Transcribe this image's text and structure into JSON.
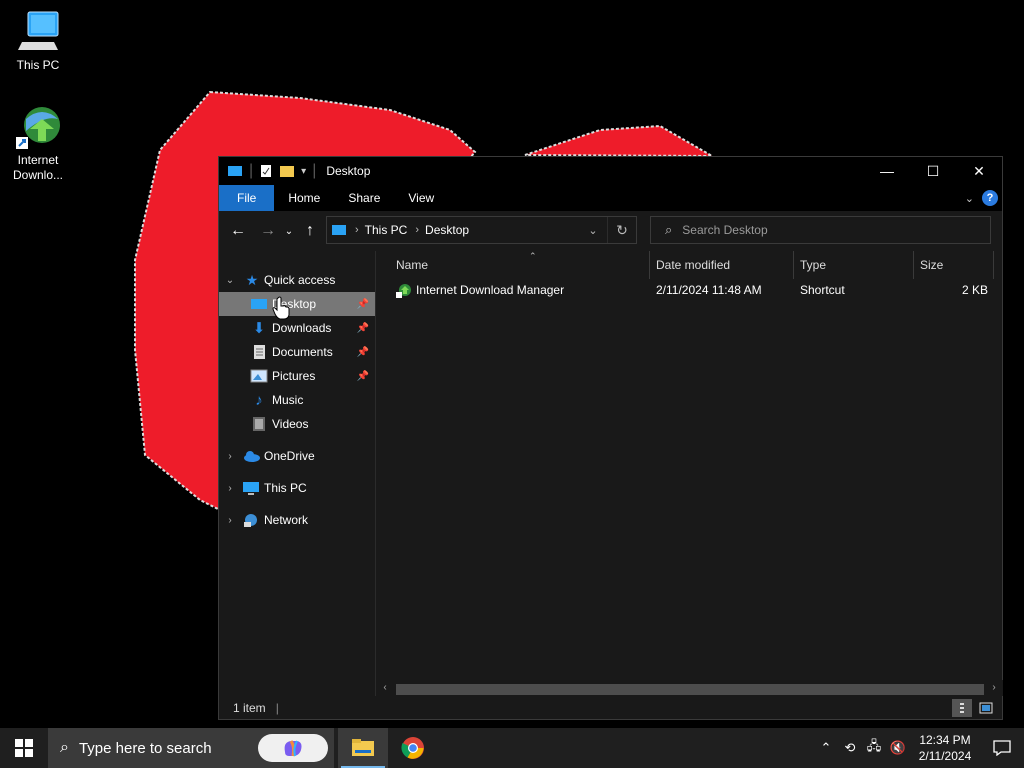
{
  "desktop": {
    "icons": [
      {
        "label": "This PC",
        "icon": "computer-icon"
      },
      {
        "label": "Internet Downlo...",
        "icon": "idm-icon"
      }
    ],
    "wallpaper_shape_color": "#ee1c2a"
  },
  "window": {
    "title": "Desktop",
    "controls": {
      "minimize": "—",
      "maximize": "☐",
      "close": "✕"
    },
    "ribbon": {
      "tabs": [
        "File",
        "Home",
        "Share",
        "View"
      ]
    },
    "address": {
      "segments": [
        "This PC",
        "Desktop"
      ]
    },
    "search": {
      "placeholder": "Search Desktop"
    },
    "nav": {
      "quick_access": "Quick access",
      "pinned": [
        "Desktop",
        "Downloads",
        "Documents",
        "Pictures"
      ],
      "unpinned": [
        "Music",
        "Videos"
      ],
      "roots": [
        "OneDrive",
        "This PC",
        "Network"
      ]
    },
    "columns": {
      "name": "Name",
      "date": "Date modified",
      "type": "Type",
      "size": "Size"
    },
    "files": [
      {
        "name": "Internet Download Manager",
        "date": "2/11/2024 11:48 AM",
        "type": "Shortcut",
        "size": "2 KB"
      }
    ],
    "status": {
      "count": "1 item"
    }
  },
  "taskbar": {
    "search_placeholder": "Type here to search",
    "time": "12:34 PM",
    "date": "2/11/2024"
  },
  "colors": {
    "accent": "#1a6fc7",
    "selection": "#777777",
    "folder": "#f3c94f"
  }
}
